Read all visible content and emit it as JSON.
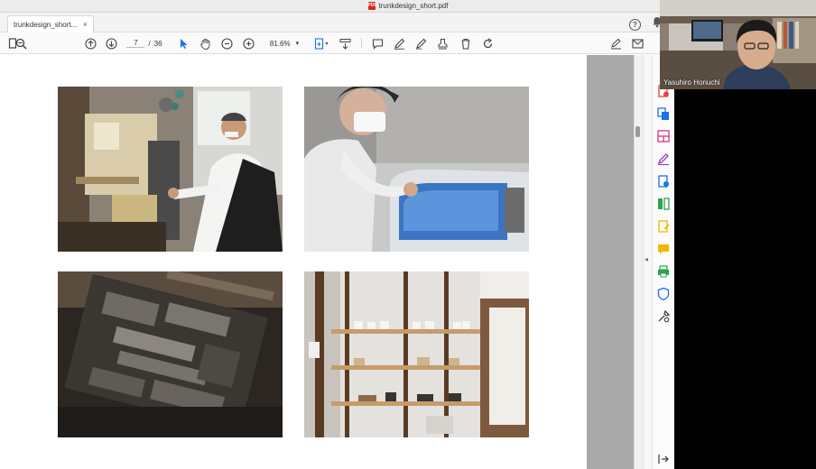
{
  "window": {
    "title": "trunkdesign_short.pdf",
    "pdf_badge": "PDF"
  },
  "tab": {
    "label": "trunkdesign_short...",
    "close": "×"
  },
  "tabbar_right": {
    "help": "?"
  },
  "toolbar": {
    "page_current": "7",
    "page_sep": "/",
    "page_total": "36",
    "zoom": "81.6%",
    "zoom_caret": "▾",
    "export_caret": "▾"
  },
  "photos": [
    {
      "id": "photo-letterpress-machine",
      "subject": "man operating letterpress machine"
    },
    {
      "id": "photo-worker-printer",
      "subject": "worker at blue printing machine"
    },
    {
      "id": "photo-lead-type",
      "subject": "metal type blocks"
    },
    {
      "id": "photo-shelves",
      "subject": "wooden shelves with ceramics"
    }
  ],
  "right_pane": {
    "collapse_glyph": "◂"
  },
  "video": {
    "participant_name": "Yasuhiro Horiuchi"
  },
  "colors": {
    "accent_blue": "#1a73e8",
    "tool_red": "#e8413c",
    "tool_purple": "#9b3fb5",
    "tool_pink": "#d6338a",
    "tool_green": "#2ea44f",
    "tool_yellow": "#f2b705"
  },
  "icons": [
    "bell-icon",
    "help-icon",
    "search-icon",
    "page-up-icon",
    "page-down-icon",
    "select-arrow-icon",
    "hand-icon",
    "zoom-out-icon",
    "zoom-in-icon",
    "export-icon",
    "scroll-icon",
    "comment-icon",
    "pen-icon",
    "highlight-icon",
    "stamp-icon",
    "delete-icon",
    "rotate-icon",
    "sign-icon",
    "mail-icon"
  ]
}
